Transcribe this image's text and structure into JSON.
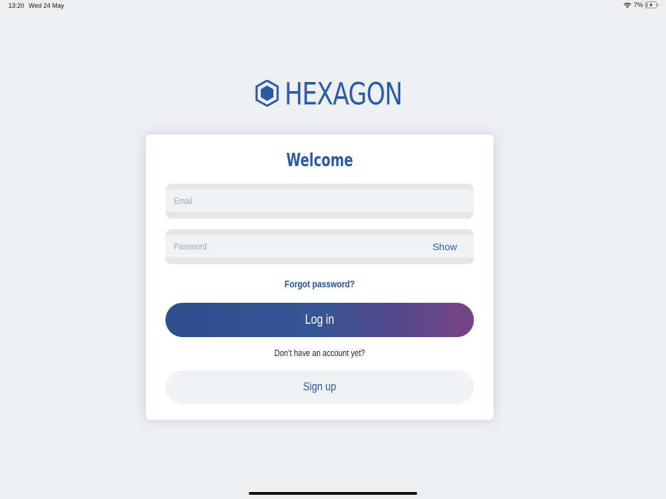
{
  "status_bar": {
    "time": "13:20",
    "date": "Wed 24 May",
    "battery_percent": "7%",
    "wifi_icon": "wifi-icon",
    "battery_icon": "battery-charging-icon"
  },
  "brand": {
    "name": "HEXAGON",
    "logo_icon": "hexagon-icon",
    "color": "#2b5ba6"
  },
  "login_card": {
    "title": "Welcome",
    "email": {
      "placeholder": "Email",
      "value": ""
    },
    "password": {
      "placeholder": "Password",
      "value": "",
      "show_label": "Show"
    },
    "forgot_password_label": "Forgot password?",
    "login_label": "Log in",
    "no_account_text": "Don’t have an account yet?",
    "signup_label": "Sign up"
  }
}
